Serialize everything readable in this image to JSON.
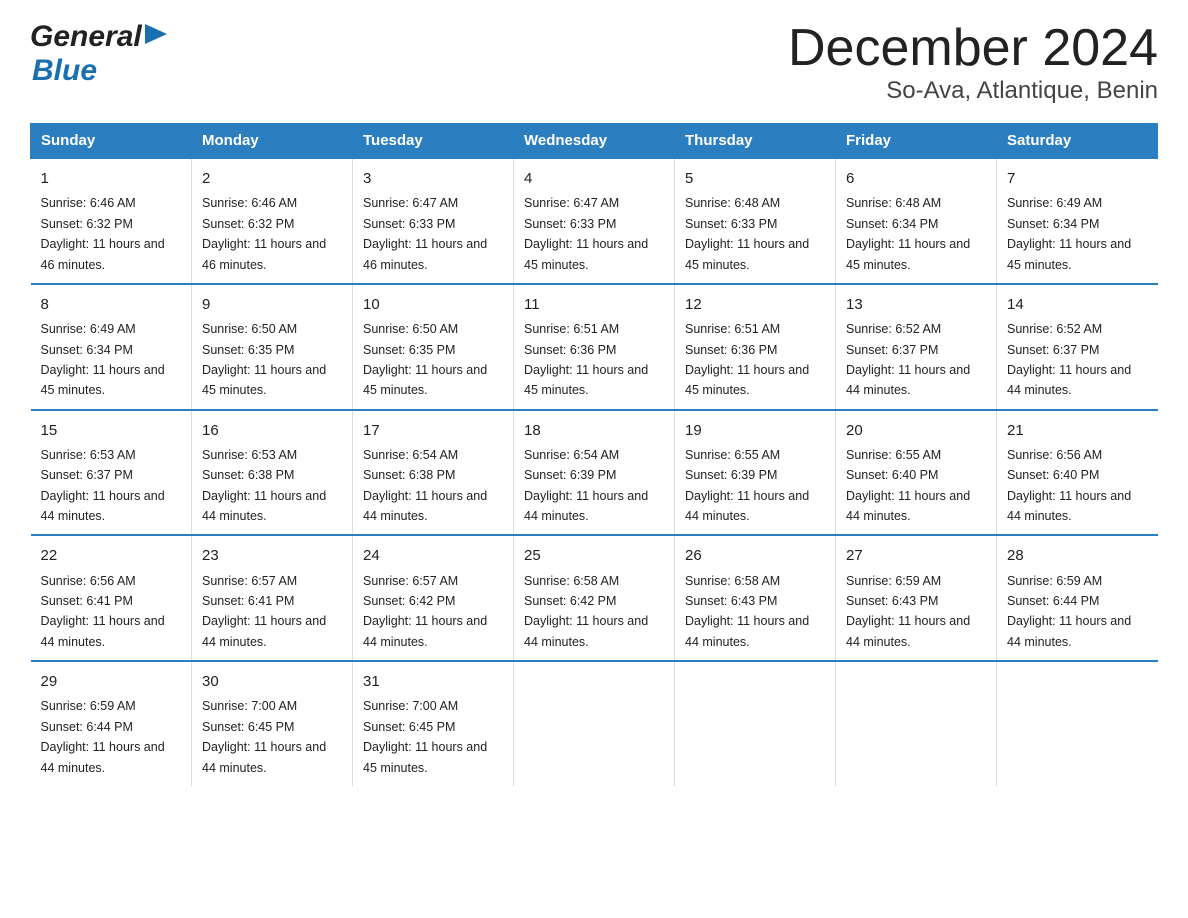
{
  "logo": {
    "text_general": "General",
    "text_blue": "Blue"
  },
  "title": "December 2024",
  "subtitle": "So-Ava, Atlantique, Benin",
  "days_of_week": [
    "Sunday",
    "Monday",
    "Tuesday",
    "Wednesday",
    "Thursday",
    "Friday",
    "Saturday"
  ],
  "weeks": [
    [
      {
        "day": "1",
        "sunrise": "6:46 AM",
        "sunset": "6:32 PM",
        "daylight": "11 hours and 46 minutes."
      },
      {
        "day": "2",
        "sunrise": "6:46 AM",
        "sunset": "6:32 PM",
        "daylight": "11 hours and 46 minutes."
      },
      {
        "day": "3",
        "sunrise": "6:47 AM",
        "sunset": "6:33 PM",
        "daylight": "11 hours and 46 minutes."
      },
      {
        "day": "4",
        "sunrise": "6:47 AM",
        "sunset": "6:33 PM",
        "daylight": "11 hours and 45 minutes."
      },
      {
        "day": "5",
        "sunrise": "6:48 AM",
        "sunset": "6:33 PM",
        "daylight": "11 hours and 45 minutes."
      },
      {
        "day": "6",
        "sunrise": "6:48 AM",
        "sunset": "6:34 PM",
        "daylight": "11 hours and 45 minutes."
      },
      {
        "day": "7",
        "sunrise": "6:49 AM",
        "sunset": "6:34 PM",
        "daylight": "11 hours and 45 minutes."
      }
    ],
    [
      {
        "day": "8",
        "sunrise": "6:49 AM",
        "sunset": "6:34 PM",
        "daylight": "11 hours and 45 minutes."
      },
      {
        "day": "9",
        "sunrise": "6:50 AM",
        "sunset": "6:35 PM",
        "daylight": "11 hours and 45 minutes."
      },
      {
        "day": "10",
        "sunrise": "6:50 AM",
        "sunset": "6:35 PM",
        "daylight": "11 hours and 45 minutes."
      },
      {
        "day": "11",
        "sunrise": "6:51 AM",
        "sunset": "6:36 PM",
        "daylight": "11 hours and 45 minutes."
      },
      {
        "day": "12",
        "sunrise": "6:51 AM",
        "sunset": "6:36 PM",
        "daylight": "11 hours and 45 minutes."
      },
      {
        "day": "13",
        "sunrise": "6:52 AM",
        "sunset": "6:37 PM",
        "daylight": "11 hours and 44 minutes."
      },
      {
        "day": "14",
        "sunrise": "6:52 AM",
        "sunset": "6:37 PM",
        "daylight": "11 hours and 44 minutes."
      }
    ],
    [
      {
        "day": "15",
        "sunrise": "6:53 AM",
        "sunset": "6:37 PM",
        "daylight": "11 hours and 44 minutes."
      },
      {
        "day": "16",
        "sunrise": "6:53 AM",
        "sunset": "6:38 PM",
        "daylight": "11 hours and 44 minutes."
      },
      {
        "day": "17",
        "sunrise": "6:54 AM",
        "sunset": "6:38 PM",
        "daylight": "11 hours and 44 minutes."
      },
      {
        "day": "18",
        "sunrise": "6:54 AM",
        "sunset": "6:39 PM",
        "daylight": "11 hours and 44 minutes."
      },
      {
        "day": "19",
        "sunrise": "6:55 AM",
        "sunset": "6:39 PM",
        "daylight": "11 hours and 44 minutes."
      },
      {
        "day": "20",
        "sunrise": "6:55 AM",
        "sunset": "6:40 PM",
        "daylight": "11 hours and 44 minutes."
      },
      {
        "day": "21",
        "sunrise": "6:56 AM",
        "sunset": "6:40 PM",
        "daylight": "11 hours and 44 minutes."
      }
    ],
    [
      {
        "day": "22",
        "sunrise": "6:56 AM",
        "sunset": "6:41 PM",
        "daylight": "11 hours and 44 minutes."
      },
      {
        "day": "23",
        "sunrise": "6:57 AM",
        "sunset": "6:41 PM",
        "daylight": "11 hours and 44 minutes."
      },
      {
        "day": "24",
        "sunrise": "6:57 AM",
        "sunset": "6:42 PM",
        "daylight": "11 hours and 44 minutes."
      },
      {
        "day": "25",
        "sunrise": "6:58 AM",
        "sunset": "6:42 PM",
        "daylight": "11 hours and 44 minutes."
      },
      {
        "day": "26",
        "sunrise": "6:58 AM",
        "sunset": "6:43 PM",
        "daylight": "11 hours and 44 minutes."
      },
      {
        "day": "27",
        "sunrise": "6:59 AM",
        "sunset": "6:43 PM",
        "daylight": "11 hours and 44 minutes."
      },
      {
        "day": "28",
        "sunrise": "6:59 AM",
        "sunset": "6:44 PM",
        "daylight": "11 hours and 44 minutes."
      }
    ],
    [
      {
        "day": "29",
        "sunrise": "6:59 AM",
        "sunset": "6:44 PM",
        "daylight": "11 hours and 44 minutes."
      },
      {
        "day": "30",
        "sunrise": "7:00 AM",
        "sunset": "6:45 PM",
        "daylight": "11 hours and 44 minutes."
      },
      {
        "day": "31",
        "sunrise": "7:00 AM",
        "sunset": "6:45 PM",
        "daylight": "11 hours and 45 minutes."
      },
      null,
      null,
      null,
      null
    ]
  ]
}
